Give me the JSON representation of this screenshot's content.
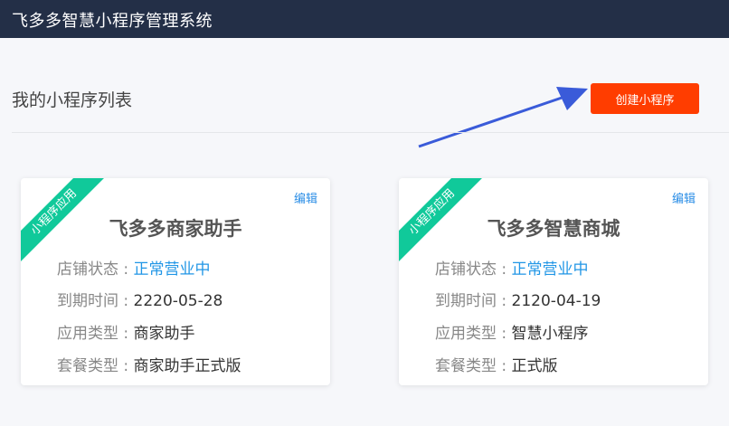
{
  "header": {
    "title": "飞多多智慧小程序管理系统"
  },
  "main": {
    "section_title": "我的小程序列表",
    "create_button_label": "创建小程序"
  },
  "colors": {
    "topbar": "#232f47",
    "create_button": "#ff3d00",
    "ribbon": "#10c99a",
    "status_text": "#2196e6",
    "arrow": "#3a5bd9"
  },
  "cards": [
    {
      "ribbon": "小程序应用",
      "edit_label": "编辑",
      "name": "飞多多商家助手",
      "rows": [
        {
          "label": "店铺状态 : ",
          "value": "正常营业中"
        },
        {
          "label": "到期时间 : ",
          "value": "2220-05-28"
        },
        {
          "label": "应用类型 : ",
          "value": "商家助手"
        },
        {
          "label": "套餐类型 : ",
          "value": "商家助手正式版"
        }
      ]
    },
    {
      "ribbon": "小程序应用",
      "edit_label": "编辑",
      "name": "飞多多智慧商城",
      "rows": [
        {
          "label": "店铺状态 : ",
          "value": "正常营业中"
        },
        {
          "label": "到期时间 : ",
          "value": "2120-04-19"
        },
        {
          "label": "应用类型 : ",
          "value": "智慧小程序"
        },
        {
          "label": "套餐类型 : ",
          "value": "正式版"
        }
      ]
    }
  ]
}
